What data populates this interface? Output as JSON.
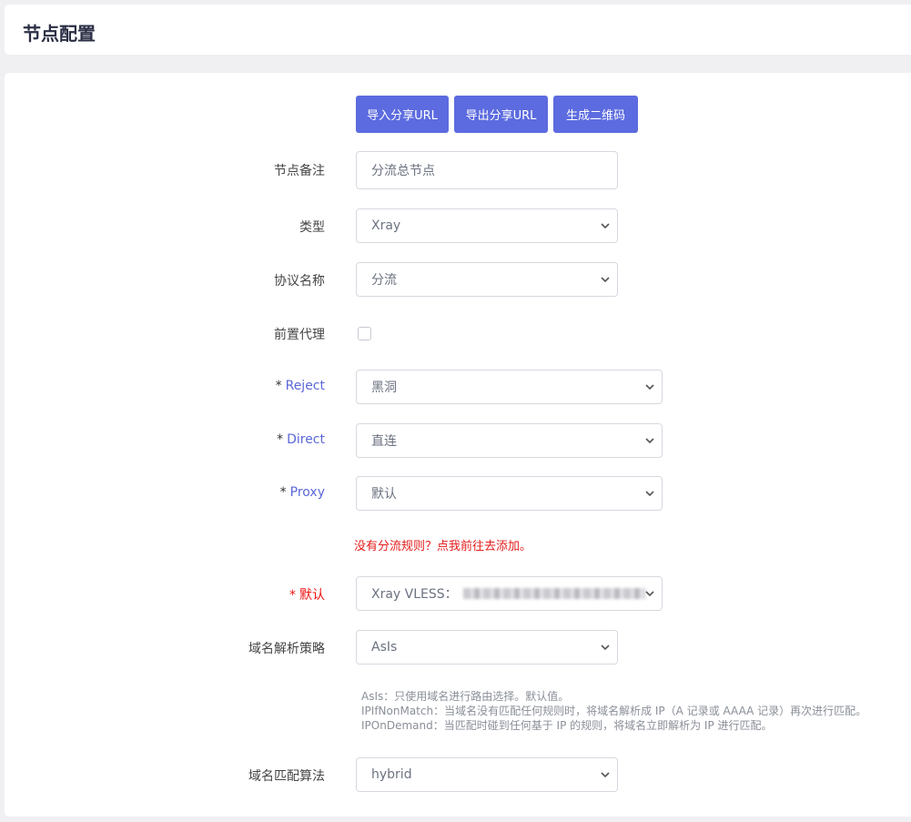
{
  "header": {
    "title": "节点配置"
  },
  "toolbar": {
    "import_label": "导入分享URL",
    "export_label": "导出分享URL",
    "qrcode_label": "生成二维码"
  },
  "form": {
    "remark": {
      "label": "节点备注",
      "value": "分流总节点"
    },
    "type": {
      "label": "类型",
      "value": "Xray"
    },
    "protocol": {
      "label": "协议名称",
      "value": "分流"
    },
    "preproxy": {
      "label": "前置代理",
      "checked": false
    },
    "reject": {
      "star": "*",
      "label": "Reject",
      "value": "黑洞"
    },
    "direct": {
      "star": "*",
      "label": "Direct",
      "value": "直连"
    },
    "proxy": {
      "star": "*",
      "label": "Proxy",
      "value": "默认"
    },
    "no_rules_warning": "没有分流规则？点我前往去添加。",
    "default": {
      "star": "*",
      "label": "默认",
      "value": "Xray VLESS："
    },
    "domain_strategy": {
      "label": "域名解析策略",
      "value": "AsIs",
      "hints": [
        "AsIs：只使用域名进行路由选择。默认值。",
        "IPIfNonMatch：当域名没有匹配任何规则时，将域名解析成 IP（A 记录或 AAAA 记录）再次进行匹配。",
        "IPOnDemand：当匹配时碰到任何基于 IP 的规则，将域名立即解析为 IP 进行匹配。"
      ]
    },
    "domain_matcher": {
      "label": "域名匹配算法",
      "value": "hybrid"
    }
  },
  "colors": {
    "primary": "#5c6bdf",
    "required_label": "#5a67d8",
    "warning": "#e41b1b"
  },
  "icons": {
    "select_arrow": "chevron-down-icon"
  }
}
